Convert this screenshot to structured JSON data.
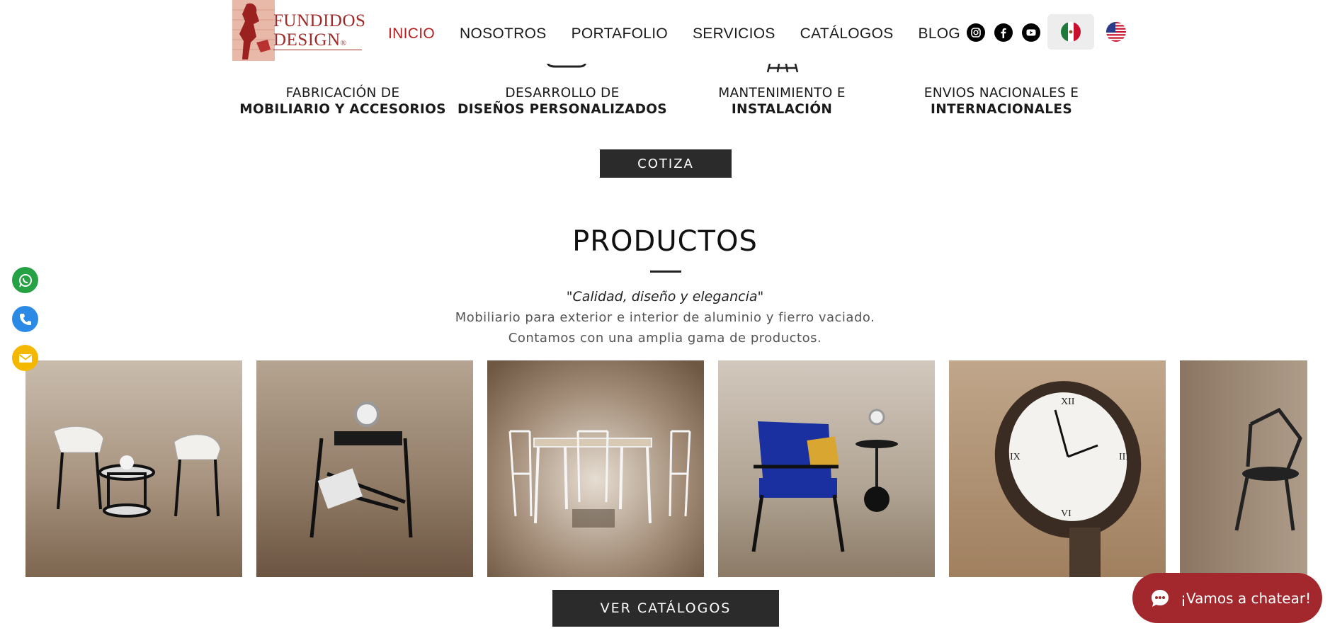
{
  "logo": {
    "line1": "FUNDIDOS",
    "line2": "DESIGN",
    "mark": "®"
  },
  "nav": [
    {
      "label": "INICIO",
      "active": true
    },
    {
      "label": "NOSOTROS",
      "active": false
    },
    {
      "label": "PORTAFOLIO",
      "active": false
    },
    {
      "label": "SERVICIOS",
      "active": false
    },
    {
      "label": "CATÁLOGOS",
      "active": false
    },
    {
      "label": "BLOG",
      "active": false
    }
  ],
  "social": [
    "instagram-icon",
    "facebook-icon",
    "youtube-icon"
  ],
  "languages": [
    {
      "name": "mexico-flag-icon",
      "selected": true
    },
    {
      "name": "usa-flag-icon",
      "selected": false
    }
  ],
  "services": [
    {
      "line1": "FABRICACIÓN DE",
      "line2": "MOBILIARIO Y ACCESORIOS"
    },
    {
      "line1": "DESARROLLO DE",
      "line2": "DISEÑOS PERSONALIZADOS"
    },
    {
      "line1": "MANTENIMIENTO E",
      "line2": "INSTALACIÓN"
    },
    {
      "line1": "ENVIOS NACIONALES E",
      "line2": "INTERNACIONALES"
    }
  ],
  "cotiza_label": "COTIZA",
  "products": {
    "title": "PRODUCTOS",
    "tagline": "\"Calidad, diseño y elegancia\"",
    "desc1": "Mobiliario para exterior e interior de aluminio y fierro vaciado.",
    "desc2": "Contamos con una amplia gama de productos."
  },
  "gallery": [
    "white-chairs-side-table-image",
    "black-side-table-clock-image",
    "white-dining-set-image",
    "blue-armchair-image",
    "street-clock-image",
    "black-chair-image"
  ],
  "catalog_label": "VER CATÁLOGOS",
  "chat_label": "¡Vamos a chatear!",
  "colors": {
    "accent": "#b31e1e",
    "dark_button": "#2b2b2b",
    "chat": "#a3282d",
    "whatsapp": "#25a244",
    "phone": "#2b8ae6",
    "email": "#f5b800"
  }
}
